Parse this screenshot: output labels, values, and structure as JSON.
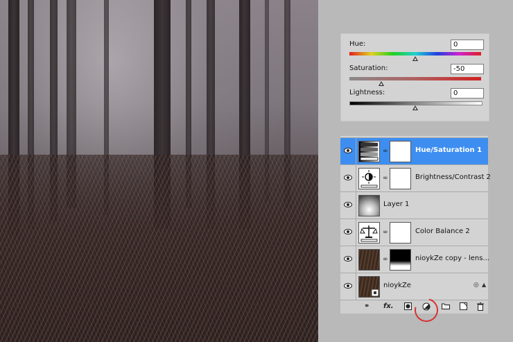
{
  "hue_saturation": {
    "hue_label": "Hue:",
    "hue_value": "0",
    "saturation_label": "Saturation:",
    "saturation_value": "-50",
    "lightness_label": "Lightness:",
    "lightness_value": "0"
  },
  "layers": [
    {
      "name": "Hue/Saturation 1",
      "selected": true,
      "type": "adjustment"
    },
    {
      "name": "Brightness/Contrast 2",
      "selected": false,
      "type": "adjustment"
    },
    {
      "name": "Layer 1",
      "selected": false,
      "type": "pixel"
    },
    {
      "name": "Color Balance 2",
      "selected": false,
      "type": "adjustment"
    },
    {
      "name": "nioykZe copy - lens...",
      "selected": false,
      "type": "masked"
    },
    {
      "name": "nioykZe",
      "selected": false,
      "type": "smart"
    }
  ],
  "bottom_bar": {
    "fx_label": "fx.",
    "icons": [
      "link-icon",
      "fx-icon",
      "mask-icon",
      "adjustment-icon",
      "folder-icon",
      "new-layer-icon",
      "trash-icon"
    ]
  },
  "colors": {
    "selection": "#3d8ef0",
    "panel": "#d3d3d3",
    "highlight_circle": "#d83030"
  }
}
